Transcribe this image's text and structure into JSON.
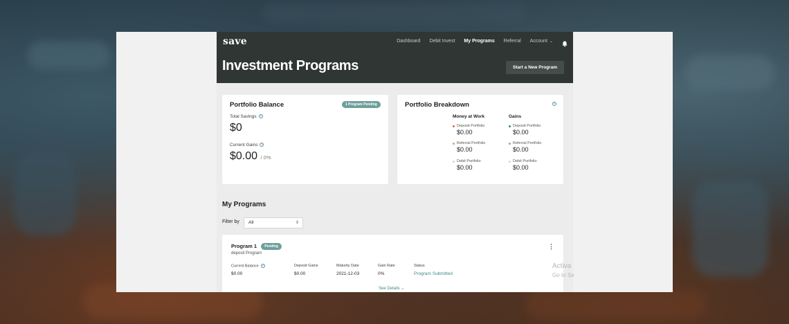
{
  "app": {
    "logo": "save",
    "title": "Investment Programs",
    "start_button": "Start a New Program"
  },
  "nav": {
    "items": [
      "Dashboard",
      "Debit Invest",
      "My Programs",
      "Referral",
      "Account"
    ],
    "active": "My Programs"
  },
  "portfolio_balance": {
    "title": "Portfolio Balance",
    "badge": "1 Program Pending",
    "total_savings_label": "Total Savings",
    "total_savings_value": "$0",
    "current_gains_label": "Current Gains",
    "current_gains_value": "$0.00",
    "current_gains_pct": "/ 0%"
  },
  "portfolio_breakdown": {
    "title": "Portfolio Breakdown",
    "money_at_work_label": "Money at Work",
    "gains_label": "Gains",
    "money_at_work": [
      {
        "name": "Deposit Portfolio",
        "value": "$0.00",
        "color": "#e0683a"
      },
      {
        "name": "Referral Portfolio",
        "value": "$0.00",
        "color": "#e89a6a"
      },
      {
        "name": "Debit Portfolio",
        "value": "$0.00",
        "color": "#d6d6d6"
      }
    ],
    "gains": [
      {
        "name": "Deposit Portfolio",
        "value": "$0.00",
        "color": "#3a8a6e"
      },
      {
        "name": "Referral Portfolio",
        "value": "$0.00",
        "color": "#7fb8a8"
      },
      {
        "name": "Debit Portfolio",
        "value": "$0.00",
        "color": "#d6d6d6"
      }
    ]
  },
  "my_programs": {
    "title": "My Programs",
    "filter_label": "Filter by",
    "filter_value": "All",
    "program": {
      "name": "Program 1",
      "badge": "Pending",
      "subtitle": "deposit Program",
      "current_balance_label": "Current Balance",
      "current_balance": "$0.00",
      "deposit_gains_label": "Deposit Gains",
      "deposit_gains": "$0.00",
      "maturity_date_label": "Maturity Date",
      "maturity_date": "2021-12-03",
      "gain_rate_label": "Gain Rate",
      "gain_rate": "0%",
      "status_label": "Status",
      "status": "Program Submitted",
      "see_details": "See Details"
    }
  },
  "watermark": {
    "line1": "Activa",
    "line2": "Go to Se"
  }
}
